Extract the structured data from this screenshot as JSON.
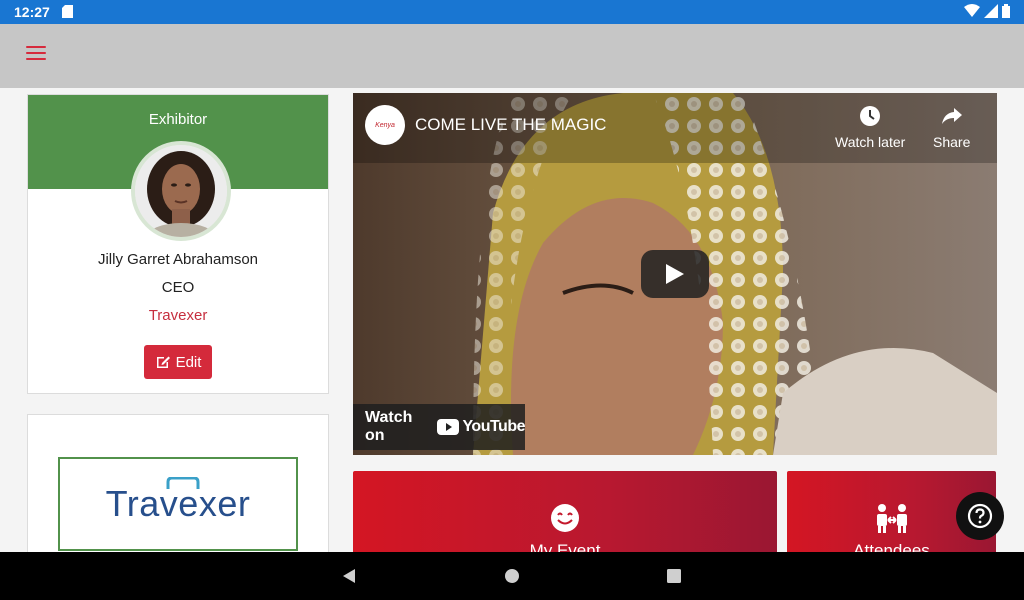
{
  "status_bar": {
    "time": "12:27"
  },
  "profile": {
    "role": "Exhibitor",
    "name": "Jilly Garret Abrahamson",
    "title": "CEO",
    "company": "Travexer",
    "edit_label": "Edit"
  },
  "sponsor_logo": {
    "text": "Travexer"
  },
  "video": {
    "channel_logo_text": "Kenya",
    "title": "COME LIVE THE MAGIC",
    "watch_later_label": "Watch later",
    "share_label": "Share",
    "watch_on_label": "Watch on",
    "youtube_label": "YouTube"
  },
  "tiles": [
    {
      "label": "My Event",
      "icon": "smile-icon"
    },
    {
      "label": "Attendees",
      "icon": "people-icon"
    }
  ],
  "colors": {
    "status_bar": "#1976d2",
    "app_bar": "#c6c6c6",
    "accent_red": "#d42a3b",
    "exhibitor_green": "#52924b"
  }
}
